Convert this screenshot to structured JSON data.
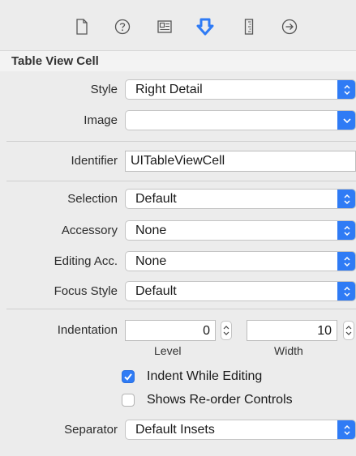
{
  "toolbar": {
    "tabs": [
      {
        "icon": "file-icon"
      },
      {
        "icon": "help-icon"
      },
      {
        "icon": "identity-icon"
      },
      {
        "icon": "attributes-icon",
        "selected": true
      },
      {
        "icon": "ruler-icon"
      },
      {
        "icon": "connections-icon"
      }
    ],
    "accent": "#2f7bf5"
  },
  "section": {
    "title": "Table View Cell"
  },
  "fields": {
    "style": {
      "label": "Style",
      "value": "Right Detail"
    },
    "image": {
      "label": "Image",
      "value": ""
    },
    "identifier": {
      "label": "Identifier",
      "value": "UITableViewCell"
    },
    "selection": {
      "label": "Selection",
      "value": "Default"
    },
    "accessory": {
      "label": "Accessory",
      "value": "None"
    },
    "editing_acc": {
      "label": "Editing Acc.",
      "value": "None"
    },
    "focus_style": {
      "label": "Focus Style",
      "value": "Default"
    },
    "indentation": {
      "label": "Indentation",
      "level_value": "0",
      "level_label": "Level",
      "width_value": "10",
      "width_label": "Width"
    },
    "indent_while_editing": {
      "label": "Indent While Editing",
      "checked": true
    },
    "shows_reorder": {
      "label": "Shows Re-order Controls",
      "checked": false
    },
    "separator": {
      "label": "Separator",
      "value": "Default Insets"
    }
  }
}
